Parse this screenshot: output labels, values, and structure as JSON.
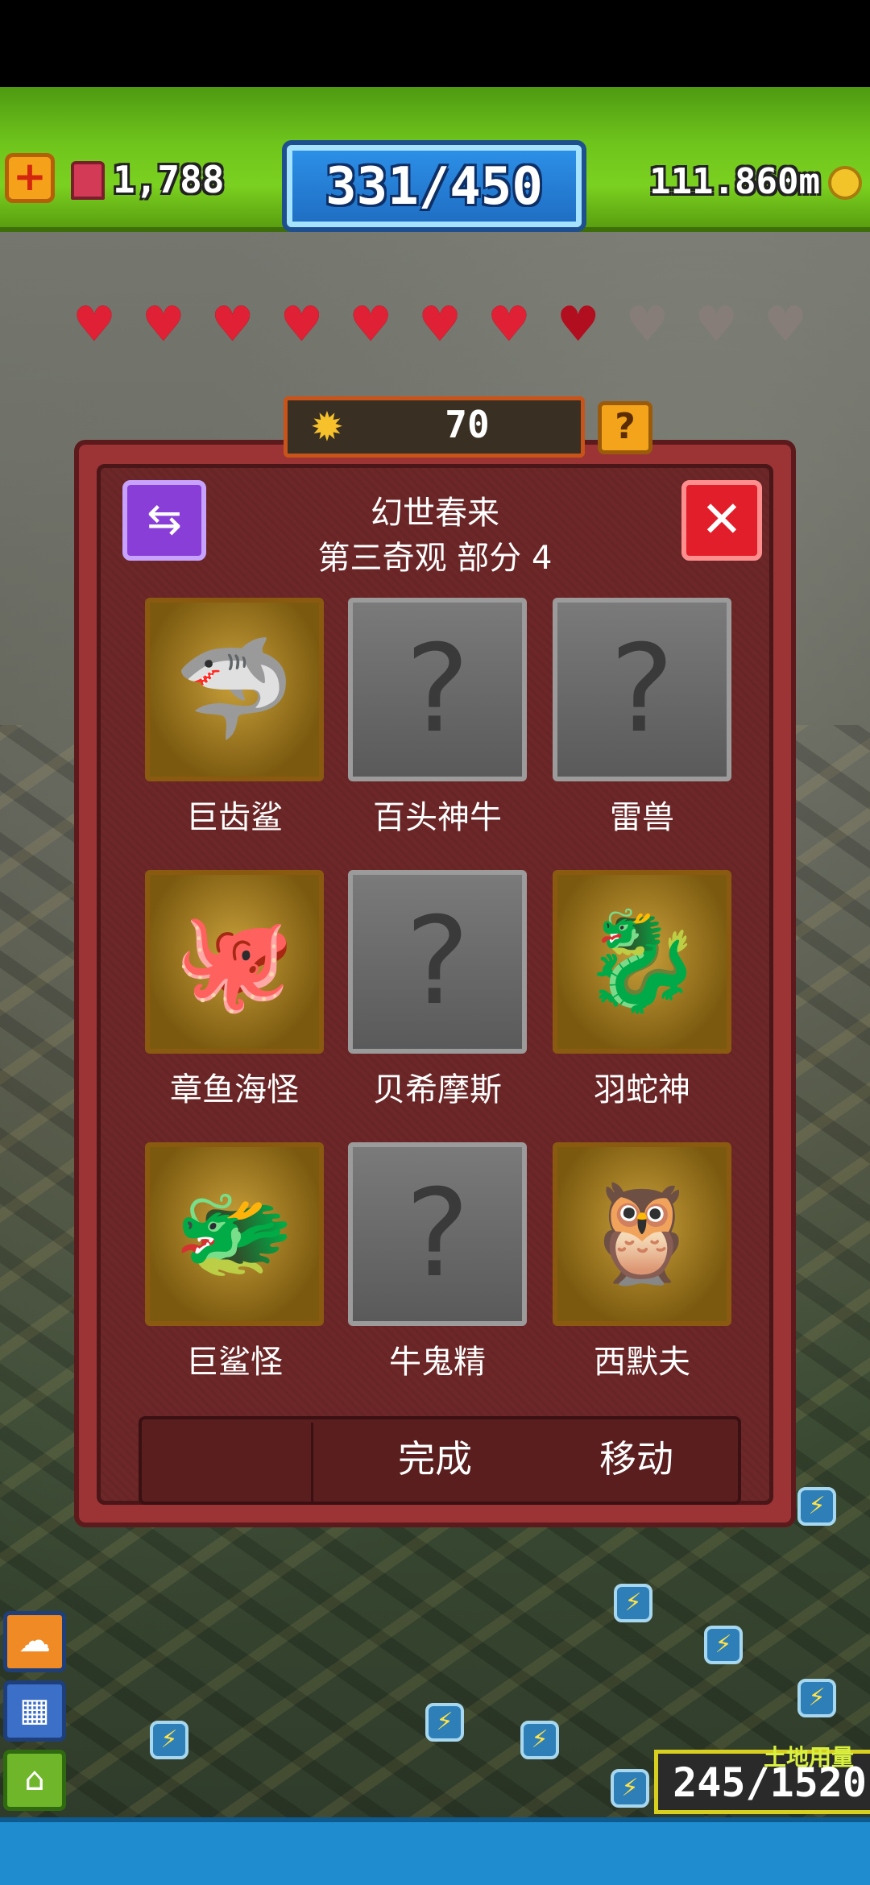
{
  "hud": {
    "tickets": "1,788",
    "population": "331/450",
    "coins": "111.860m",
    "hearts": {
      "total": 11,
      "full": 8
    }
  },
  "modal": {
    "gems": "70",
    "help_label": "?",
    "title": "幻世春来",
    "subtitle": "第三奇观 部分 4",
    "close_label": "✕",
    "cards": [
      {
        "name": "巨齿鲨",
        "locked": false,
        "icon": "shark-icon"
      },
      {
        "name": "百头神牛",
        "locked": true,
        "icon": "locked-silhouette-icon"
      },
      {
        "name": "雷兽",
        "locked": true,
        "icon": "locked-silhouette-icon"
      },
      {
        "name": "章鱼海怪",
        "locked": false,
        "icon": "octopus-monster-icon"
      },
      {
        "name": "贝希摩斯",
        "locked": true,
        "icon": "locked-silhouette-icon"
      },
      {
        "name": "羽蛇神",
        "locked": false,
        "icon": "feathered-serpent-icon"
      },
      {
        "name": "巨鲨怪",
        "locked": false,
        "icon": "shark-monster-icon"
      },
      {
        "name": "牛鬼精",
        "locked": true,
        "icon": "locked-silhouette-icon"
      },
      {
        "name": "西默夫",
        "locked": false,
        "icon": "simurgh-icon"
      }
    ],
    "done_label": "完成",
    "move_label": "移动"
  },
  "land": {
    "label": "土地用量",
    "value": "245/1520"
  }
}
